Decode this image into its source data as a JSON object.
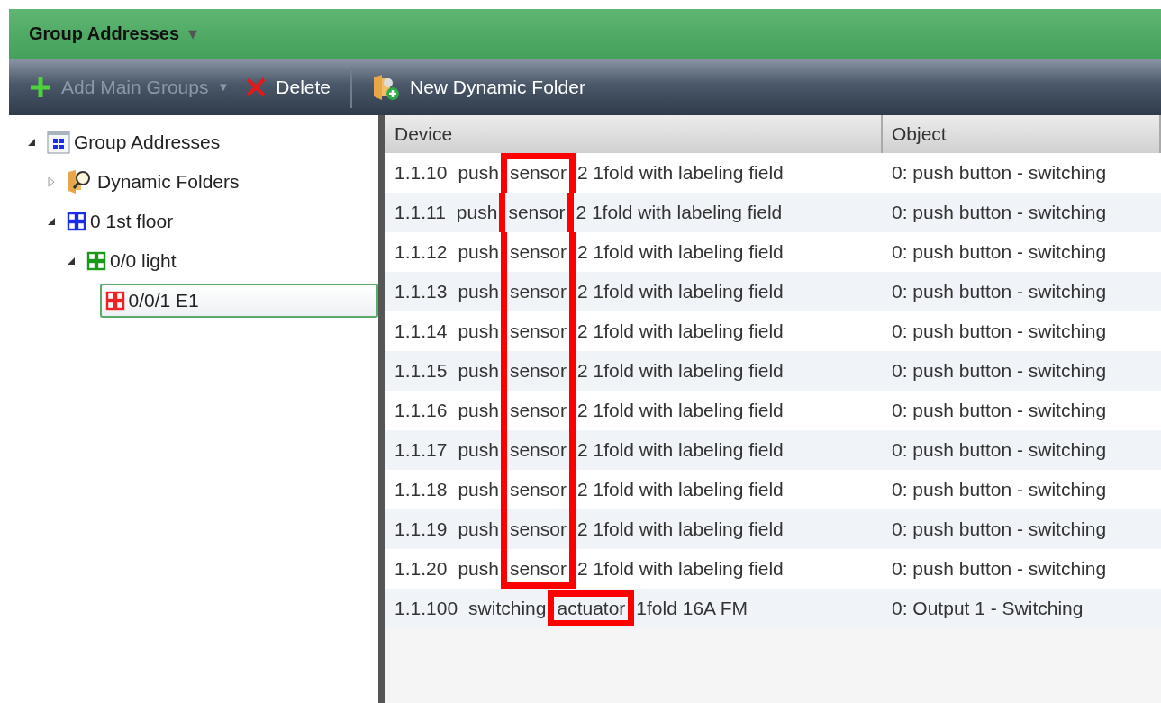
{
  "header": {
    "title": "Group Addresses",
    "caret": "▼"
  },
  "toolbar": {
    "items": [
      {
        "kind": "add",
        "label": "Add Main Groups",
        "disabled": true,
        "caret": "▼"
      },
      {
        "kind": "delete",
        "label": "Delete",
        "disabled": false
      },
      {
        "kind": "separator"
      },
      {
        "kind": "folder",
        "label": "New Dynamic Folder",
        "disabled": false
      }
    ]
  },
  "tree": [
    {
      "label": "Group Addresses",
      "kind": "root",
      "expanded": true,
      "selected": false,
      "children": [
        {
          "label": "Dynamic Folders",
          "kind": "dynamic",
          "expanded": false,
          "selected": false
        },
        {
          "label": "0 1st floor",
          "kind": "main",
          "expanded": true,
          "selected": false,
          "children": [
            {
              "label": "0/0 light",
              "kind": "middle",
              "expanded": true,
              "selected": false,
              "children": [
                {
                  "label": "0/0/1 E1",
                  "kind": "group",
                  "selected": true
                }
              ]
            }
          ]
        }
      ]
    }
  ],
  "table": {
    "columns": [
      "Device",
      "Object"
    ],
    "rows": [
      {
        "address": "1.1.10",
        "before": "push",
        "marked": "sensor",
        "after": "2 1fold with labeling field",
        "kind": "top",
        "object": "0: push button - switching"
      },
      {
        "address": "1.1.11",
        "before": "push",
        "marked": "sensor",
        "after": "2 1fold with labeling field",
        "kind": "middle",
        "object": "0: push button - switching"
      },
      {
        "address": "1.1.12",
        "before": "push",
        "marked": "sensor",
        "after": "2 1fold with labeling field",
        "kind": "middle",
        "object": "0: push button - switching"
      },
      {
        "address": "1.1.13",
        "before": "push",
        "marked": "sensor",
        "after": "2 1fold with labeling field",
        "kind": "middle",
        "object": "0: push button - switching"
      },
      {
        "address": "1.1.14",
        "before": "push",
        "marked": "sensor",
        "after": "2 1fold with labeling field",
        "kind": "middle",
        "object": "0: push button - switching"
      },
      {
        "address": "1.1.15",
        "before": "push",
        "marked": "sensor",
        "after": "2 1fold with labeling field",
        "kind": "middle",
        "object": "0: push button - switching"
      },
      {
        "address": "1.1.16",
        "before": "push",
        "marked": "sensor",
        "after": "2 1fold with labeling field",
        "kind": "middle",
        "object": "0: push button - switching"
      },
      {
        "address": "1.1.17",
        "before": "push",
        "marked": "sensor",
        "after": "2 1fold with labeling field",
        "kind": "middle",
        "object": "0: push button - switching"
      },
      {
        "address": "1.1.18",
        "before": "push",
        "marked": "sensor",
        "after": "2 1fold with labeling field",
        "kind": "middle",
        "object": "0: push button - switching"
      },
      {
        "address": "1.1.19",
        "before": "push",
        "marked": "sensor",
        "after": "2 1fold with labeling field",
        "kind": "middle",
        "object": "0: push button - switching"
      },
      {
        "address": "1.1.20",
        "before": "push",
        "marked": "sensor",
        "after": "2 1fold with labeling field",
        "kind": "bottom",
        "object": "0: push button - switching"
      },
      {
        "address": "1.1.100",
        "before": "switching",
        "marked": "actuator",
        "after": "1fold 16A FM",
        "kind": "single",
        "object": "0: Output 1 - Switching"
      }
    ]
  }
}
